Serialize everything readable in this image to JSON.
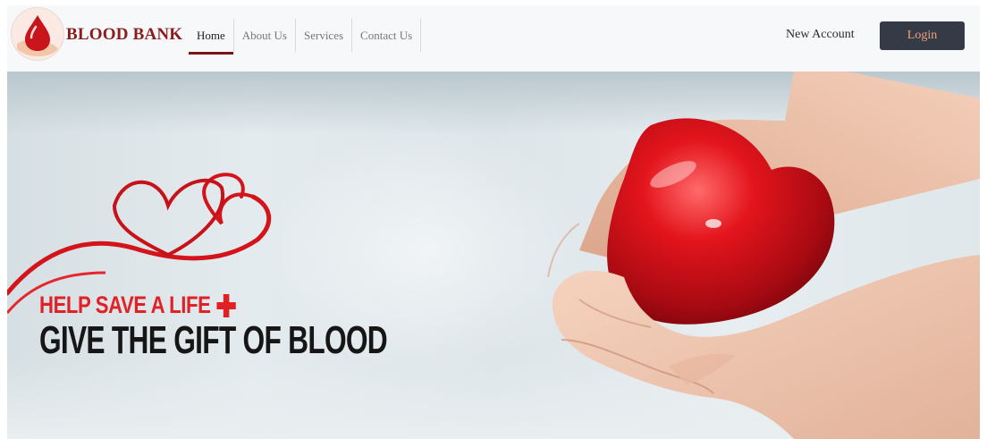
{
  "brand": {
    "name": "BLOOD BANK"
  },
  "nav": {
    "items": [
      {
        "label": "Home",
        "active": true
      },
      {
        "label": "About Us",
        "active": false
      },
      {
        "label": "Services",
        "active": false
      },
      {
        "label": "Contact Us",
        "active": false
      }
    ],
    "new_account_label": "New Account",
    "login_label": "Login"
  },
  "hero": {
    "tagline": "HELP SAVE A LIFE",
    "headline": "GIVE THE GIFT OF BLOOD"
  },
  "colors": {
    "brand": "#8c1b1b",
    "accent_red": "#e02126",
    "login_bg": "#343b46",
    "login_text": "#f0a07e"
  },
  "icons": {
    "logo": "blood-drop-in-hand-icon",
    "tagline": "plus-icon"
  }
}
